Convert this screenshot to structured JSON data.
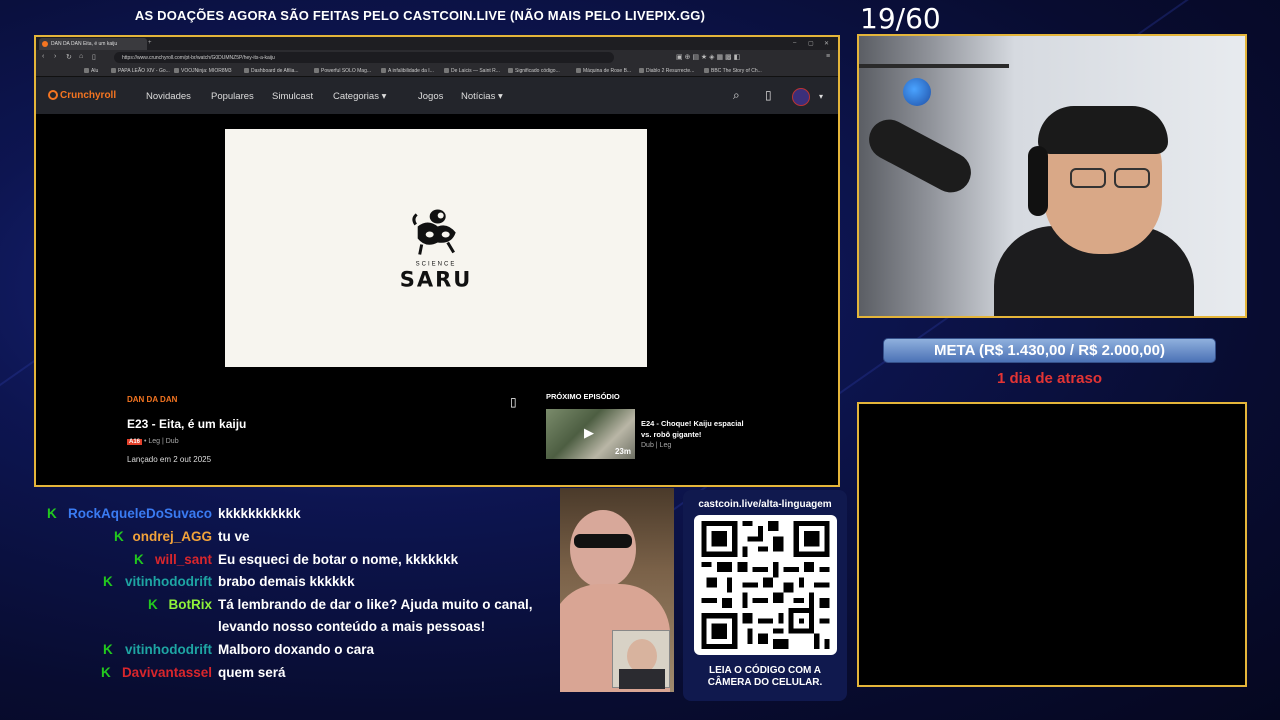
{
  "banner": "AS DOAÇÕES AGORA SÃO FEITAS PELO CASTCOIN.LIVE (NÃO MAIS PELO LIVEPIX.GG)",
  "counter": "19/60",
  "browser": {
    "tab_title": "DAN DA DAN Eita, é um kaiju",
    "url": "https://www.crunchyroll.com/pt-br/watch/G0DUMNZ5P/hey-its-a-kaiju",
    "bookmarks": [
      "Alu",
      "PAPA LEÃO XIV - Go...",
      "VOOJNinja: MIOR8M3",
      "Dashboard de Afilia...",
      "Powerful SOLO Mag...",
      "A infalibilidade da I...",
      "De Laicis — Saint R...",
      "Significado código...",
      "Máquina de Rose B...",
      "Diablo 2 Resurrecte...",
      "BBC The Story of Ch..."
    ]
  },
  "crunchyroll": {
    "logo": "Crunchyroll",
    "nav": [
      "Novidades",
      "Populares",
      "Simulcast",
      "Categorias",
      "Jogos",
      "Notícias"
    ],
    "video_brand_top": "SCIENCE",
    "video_brand": "SARU",
    "series": "DAN DA DAN",
    "episode_title": "E23 - Eita, é um kaiju",
    "rating": "A16",
    "audio": "• Leg | Dub",
    "release": "Lançado em 2 out 2025",
    "next_heading": "PRÓXIMO EPISÓDIO",
    "next_title": "E24 - Choque! Kaiju espacial vs. robô gigante!",
    "next_audio": "Dub | Leg",
    "next_duration": "23m"
  },
  "chat": [
    {
      "user": "RockAqueleDoSuvaco",
      "color": "#3a7bf2",
      "message": "kkkkkkkkkkk"
    },
    {
      "user": "ondrej_AGG",
      "color": "#f2a23a",
      "message": "tu ve"
    },
    {
      "user": "will_sant",
      "color": "#d9262c",
      "message": "Eu esqueci de botar o nome, kkkkkkk"
    },
    {
      "user": "vitinhododrift",
      "color": "#1ea5a3",
      "message": "brabo demais kkkkkk"
    },
    {
      "user": "BotRix",
      "color": "#8ff23a",
      "message": "Tá lembrando de dar o like? Ajuda muito o canal,"
    },
    {
      "user": "",
      "color": "#ffffff",
      "message": "levando nosso conteúdo a mais pessoas!"
    },
    {
      "user": "vitinhododrift",
      "color": "#1ea5a3",
      "message": "Malboro doxando o cara"
    },
    {
      "user": "Davivantassel",
      "color": "#d9262c",
      "message": "quem será"
    }
  ],
  "goal": {
    "label": "META (R$ 1.430,00 / R$ 2.000,00)",
    "status": "1 dia de atraso",
    "status_color": "#e33434"
  },
  "donation": {
    "url": "castcoin.live/alta-linguagem",
    "caption_1": "LEIA O CÓDIGO COM A",
    "caption_2": "CÂMERA DO CELULAR."
  },
  "colors": {
    "accent_border": "#e4b53a",
    "crunchyroll_orange": "#f47521",
    "kick_green": "#22c91e"
  }
}
